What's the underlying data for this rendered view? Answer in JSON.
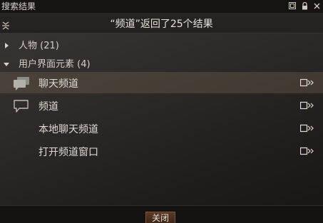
{
  "window": {
    "title": "搜索结果"
  },
  "subheader": {
    "text": "“频道”返回了25个结果"
  },
  "groups": [
    {
      "label": "人物 (21)",
      "expanded": false
    },
    {
      "label": "用户界面元素 (4)",
      "expanded": true
    }
  ],
  "items": [
    {
      "label": "聊天频道",
      "icon": "chat-bubbles-icon",
      "selected": true
    },
    {
      "label": "频道",
      "icon": "chat-bubble-icon",
      "selected": false
    },
    {
      "label": "本地聊天频道",
      "icon": "",
      "selected": false
    },
    {
      "label": "打开频道窗口",
      "icon": "",
      "selected": false
    }
  ],
  "footer": {
    "close_label": "关闭"
  }
}
